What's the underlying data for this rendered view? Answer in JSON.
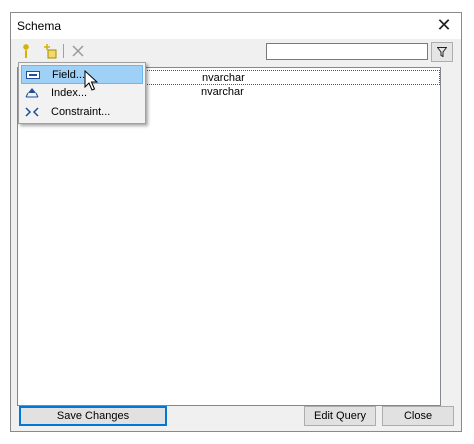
{
  "window": {
    "title": "Schema"
  },
  "toolbar": {
    "search": {
      "value": "",
      "placeholder": ""
    }
  },
  "grid": {
    "rows": [
      {
        "type": "nvarchar"
      },
      {
        "type": "nvarchar"
      }
    ]
  },
  "context_menu": {
    "items": [
      {
        "label": "Field...",
        "icon": "field-icon"
      },
      {
        "label": "Index...",
        "icon": "index-icon"
      },
      {
        "label": "Constraint...",
        "icon": "constraint-icon"
      }
    ]
  },
  "buttons": {
    "save_changes": "Save Changes",
    "edit_query": "Edit Query",
    "close": "Close"
  },
  "colors": {
    "menu_hover": "#9fd0f6",
    "accent": "#0078d7",
    "new_icon": "#d4b200"
  }
}
